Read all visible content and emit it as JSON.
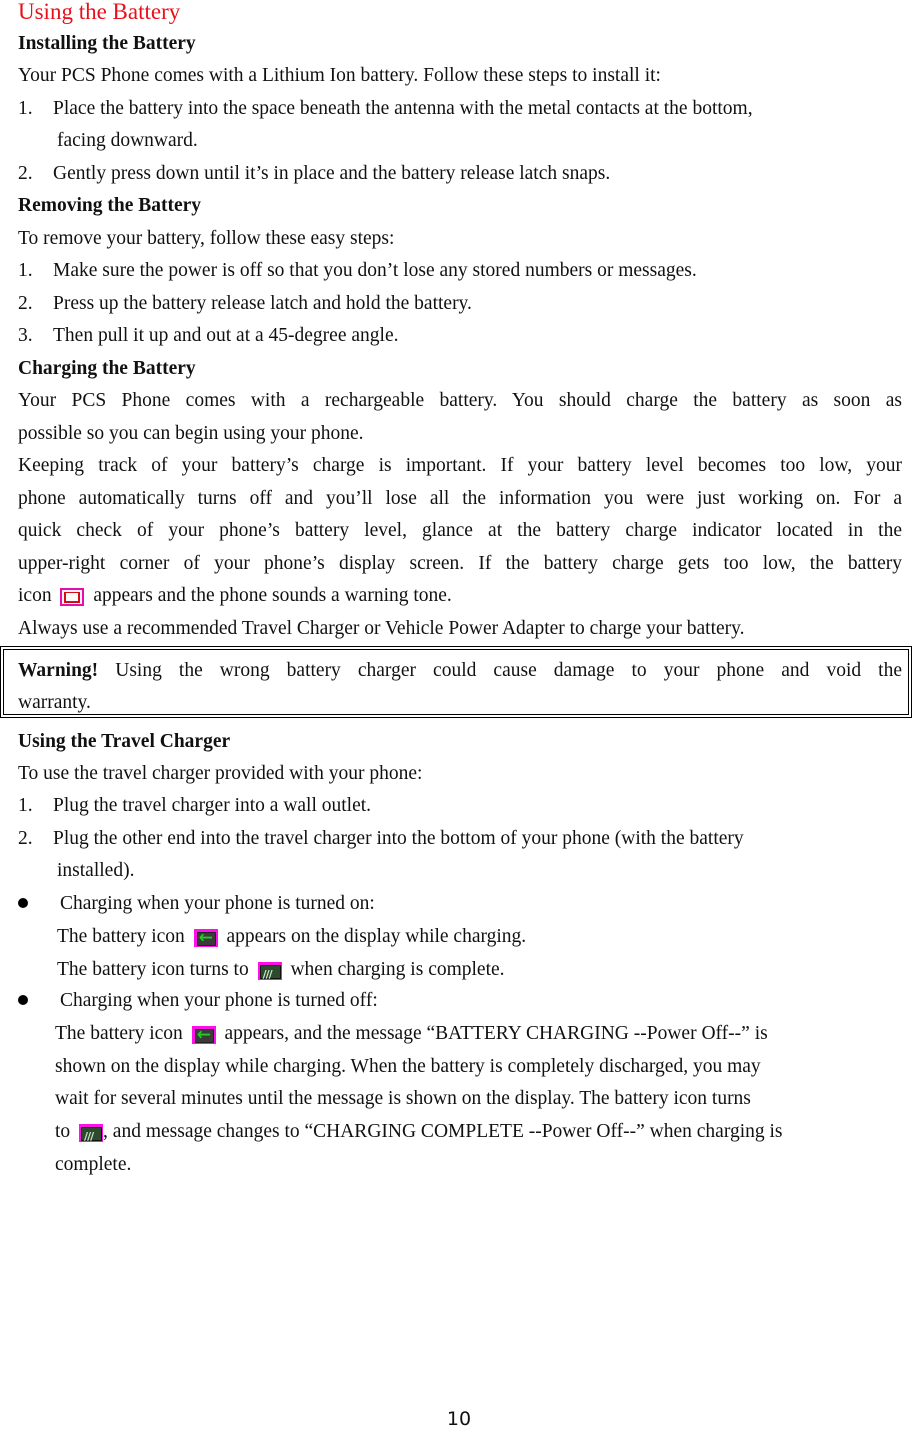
{
  "title": "Using the Battery",
  "installing": {
    "heading": "Installing the Battery",
    "intro": "Your PCS Phone comes with a Lithium Ion battery. Follow these steps to install it:",
    "steps": [
      {
        "num": "1.",
        "line1": "Place the battery into the space beneath the antenna with the metal contacts at the bottom,",
        "line2": "facing downward."
      },
      {
        "num": "2.",
        "line1": "Gently press down until it’s in place and the battery release latch snaps."
      }
    ]
  },
  "removing": {
    "heading": "Removing the Battery",
    "intro": "To remove your battery, follow these easy steps:",
    "steps": [
      {
        "num": "1.",
        "text": "Make sure the power is off so that you don’t lose any stored numbers or messages."
      },
      {
        "num": "2.",
        "text": "Press up the battery release latch and hold the battery."
      },
      {
        "num": "3.",
        "text": "Then pull it up and out at a 45-degree angle."
      }
    ]
  },
  "charging": {
    "heading": "Charging the Battery",
    "p1_line1": "Your PCS Phone comes with a rechargeable battery. You should charge the battery as soon as",
    "p1_line2": "possible so you can begin using your phone.",
    "p2_line1": "Keeping track of your battery’s charge is important. If your battery level becomes too low, your",
    "p2_line2": "phone automatically turns off and you’ll lose all the information you were just working on. For a",
    "p2_line3": "quick check of your phone’s battery level, glance at the battery charge indicator located in the",
    "p2_line4": "upper-right corner of your phone’s display screen. If the battery charge gets too low, the battery",
    "p2_line5_before": "icon",
    "p2_line5_after": "appears and the phone sounds a warning tone.",
    "p3": "Always use a recommended Travel Charger or Vehicle Power Adapter to charge your battery."
  },
  "warning": {
    "label": "Warning!",
    "line1": "Using the wrong battery charger could cause damage to your phone and void the",
    "line2": "warranty."
  },
  "travel_charger": {
    "heading": "Using the Travel Charger",
    "intro": "To use the travel charger provided with your phone:",
    "steps": [
      {
        "num": "1.",
        "line1": "Plug the travel charger into a wall outlet."
      },
      {
        "num": "2.",
        "line1": "Plug the other end into the travel charger into the bottom of your phone (with the battery",
        "line2": "installed)."
      }
    ],
    "on": {
      "heading": "Charging when your phone is turned on:",
      "l1_before": "The battery icon",
      "l1_after": "appears on the display while charging.",
      "l2_before": "The battery icon turns to",
      "l2_after": "when charging is complete."
    },
    "off": {
      "heading": "Charging when your phone is turned off:",
      "l1_before": "The battery icon",
      "l1_after": "appears, and the message “BATTERY CHARGING --Power Off--” is",
      "l2": "shown on the display while charging. When the battery is completely discharged, you may",
      "l3": "wait for several minutes until the message is shown on the display. The battery icon turns",
      "l4_before": "to",
      "l4_after": ", and message changes to “CHARGING COMPLETE --Power Off--” when charging is",
      "l5": "complete."
    }
  },
  "icons": {
    "low": "battery-low-icon",
    "charging": "battery-charging-icon",
    "full": "battery-full-icon"
  },
  "colors": {
    "title": "#e8101a",
    "icon_background": "#ff10e8",
    "charging_arrow": "#22cc22"
  },
  "page_number": "10"
}
